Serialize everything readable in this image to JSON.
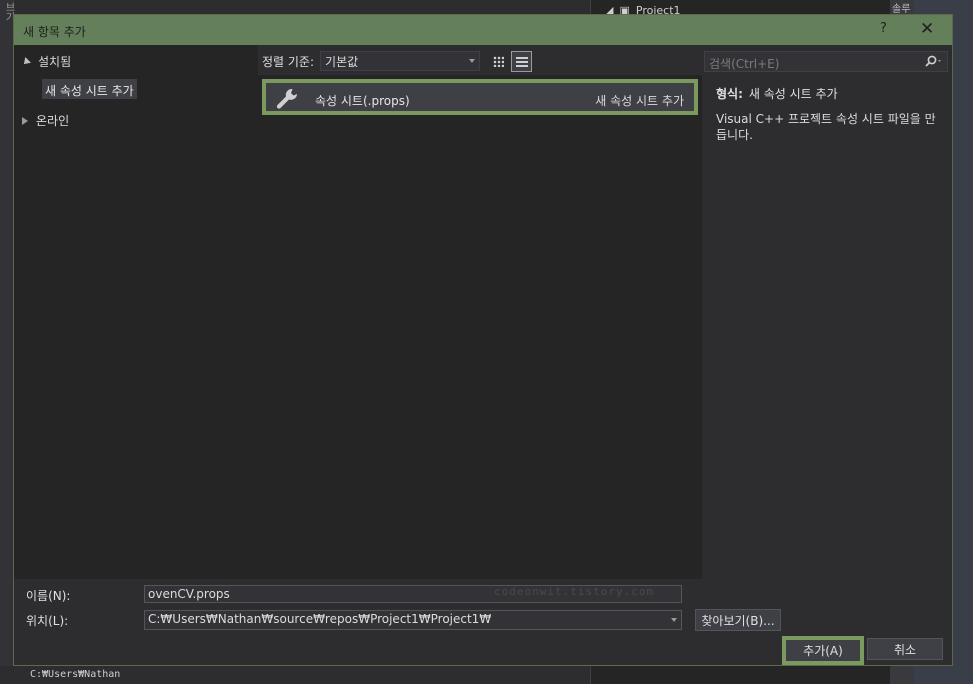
{
  "background": {
    "left_strip": "브기",
    "project_label": "Project1",
    "right_tab": "솔루",
    "status_path": "C:₩Users₩Nathan"
  },
  "dialog": {
    "title": "새 항목 추가",
    "help": "?",
    "close": "✕",
    "tree": {
      "installed": "설치됨",
      "selected": "새 속성 시트 추가",
      "online": "온라인"
    },
    "sort": {
      "label": "정렬 기준:",
      "value": "기본값"
    },
    "template": {
      "name": "속성 시트(.props)",
      "category": "새 속성 시트 추가"
    },
    "search": {
      "placeholder": "검색(Ctrl+E)"
    },
    "details": {
      "type_label": "형식:",
      "type_value": "새 속성 시트 추가",
      "description": "Visual C++ 프로젝트 속성 시트 파일을 만듭니다."
    },
    "form": {
      "name_label": "이름(N):",
      "name_value": "ovenCV.props",
      "location_label": "위치(L):",
      "location_value": "C:₩Users₩Nathan₩source₩repos₩Project1₩Project1₩",
      "watermark": "codeonwit.tistory.com",
      "browse": "찾아보기(B)...",
      "add": "추가(A)",
      "cancel": "취소"
    }
  },
  "colors": {
    "titlebar": "#64805a",
    "highlight": "#7a9a5e",
    "panel": "#252526",
    "dialog": "#2d2d30"
  }
}
